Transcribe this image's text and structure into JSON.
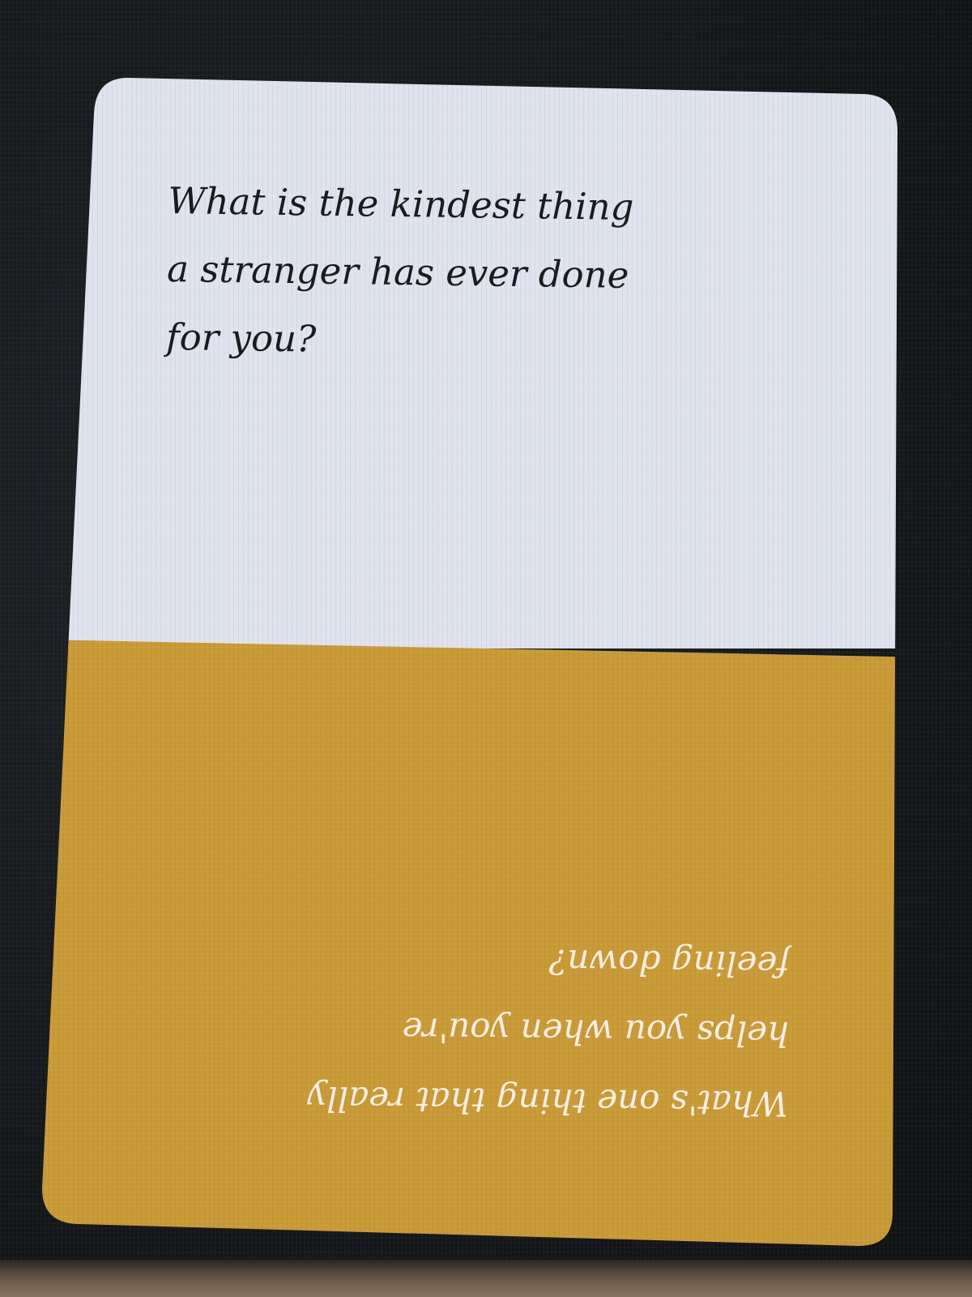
{
  "card": {
    "top_question": "What is the kindest thing\na stranger has ever done\nfor you?",
    "bottom_question": "What's one thing that really\nhelps you when you're\nfeeling down?",
    "top_color": "#dfe3ee",
    "bottom_color": "#c99a35"
  }
}
